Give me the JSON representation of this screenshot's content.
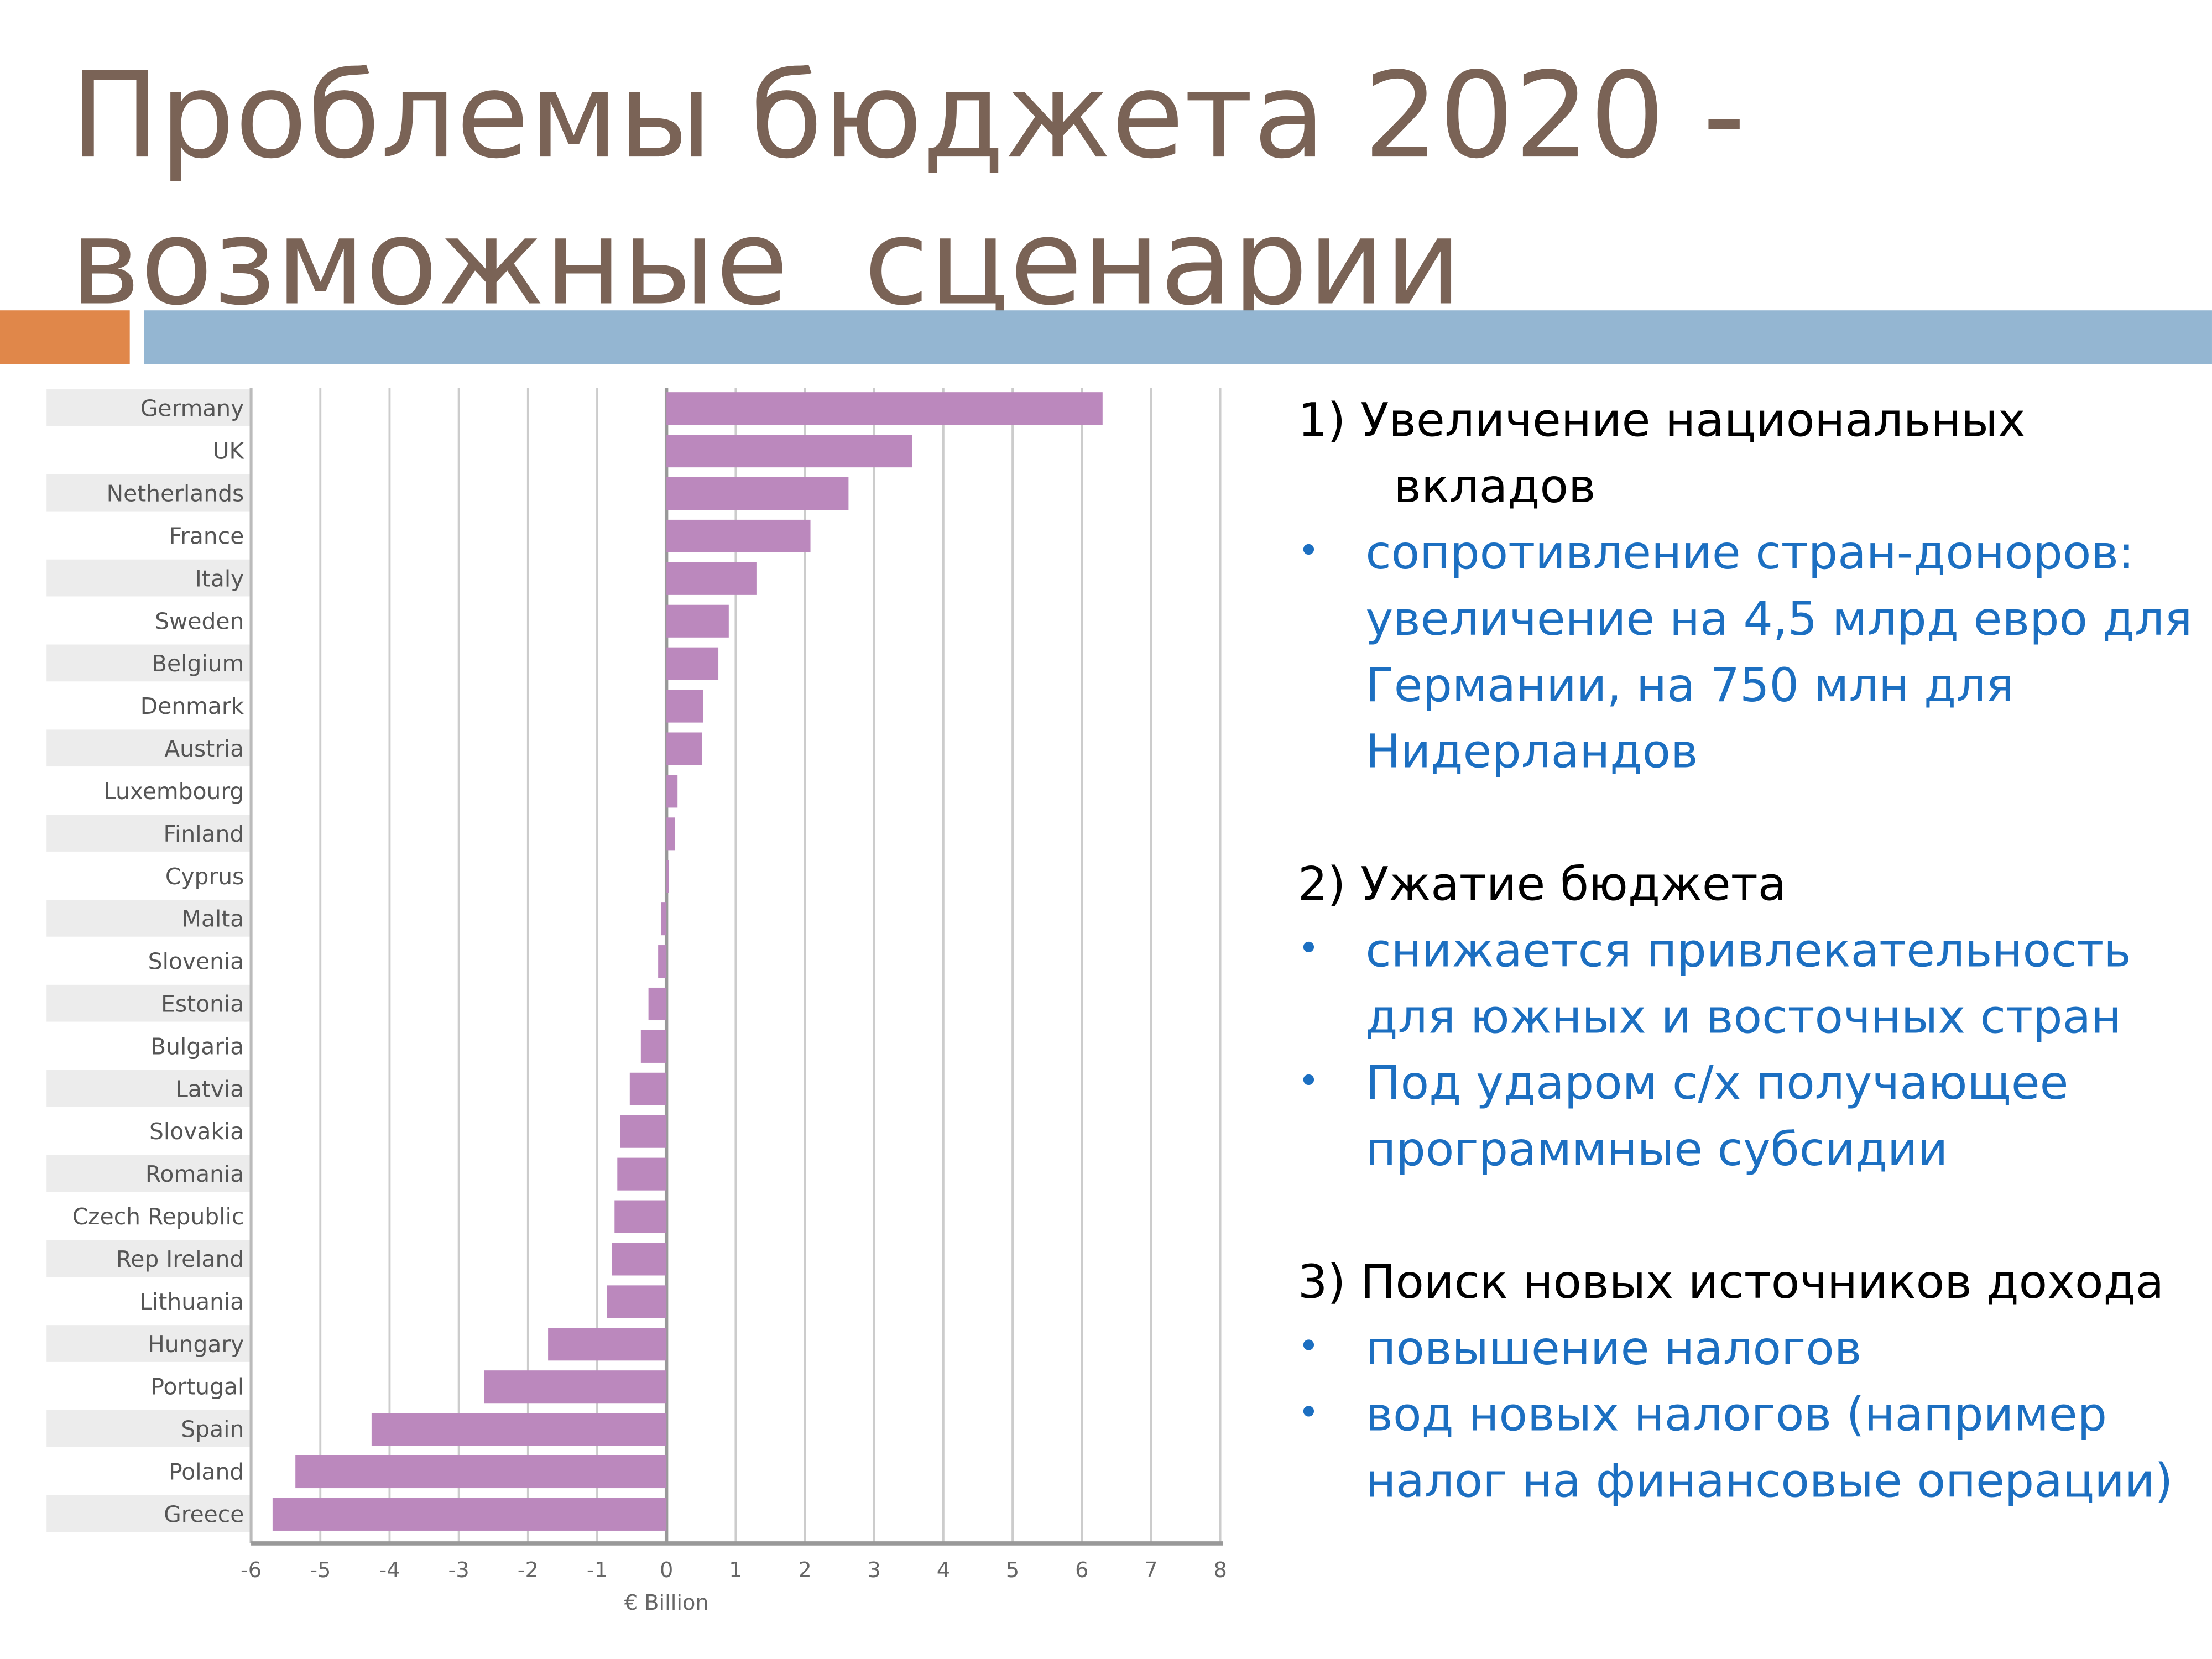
{
  "title": {
    "line1": "Проблемы бюджета 2020 -",
    "line2": "возможные  сценарии"
  },
  "colors": {
    "title": "#7a6356",
    "accent_orange": "#e0874a",
    "accent_blue": "#94b6d2",
    "bar": "#bb88bd",
    "bullet_text": "#1c6fc1"
  },
  "text": {
    "s1_heading_a": "1)  Увеличение национальных",
    "s1_heading_b": "вкладов",
    "s1_bullets": [
      "сопротивление стран-доноров:  увеличение на 4,5 млрд евро  для Германии, на 750 млн для  Нидерландов"
    ],
    "s2_heading": "2) Ужатие бюджета",
    "s2_bullets": [
      "снижается привлекательность для южных и восточных стран",
      "Под ударом с/х получающее программные субсидии"
    ],
    "s3_heading": "3) Поиск новых источников дохода",
    "s3_bullets": [
      "повышение налогов",
      "вод новых налогов (например  налог на финансовые операции)"
    ],
    "bullet_glyph": "•"
  },
  "chart_data": {
    "type": "bar",
    "orientation": "horizontal",
    "categories": [
      "Germany",
      "UK",
      "Netherlands",
      "France",
      "Italy",
      "Sweden",
      "Belgium",
      "Denmark",
      "Austria",
      "Luxembourg",
      "Finland",
      "Cyprus",
      "Malta",
      "Slovenia",
      "Estonia",
      "Bulgaria",
      "Latvia",
      "Slovakia",
      "Romania",
      "Czech Republic",
      "Rep Ireland",
      "Lithuania",
      "Hungary",
      "Portugal",
      "Spain",
      "Poland",
      "Greece"
    ],
    "values": [
      6.3,
      3.55,
      2.63,
      2.08,
      1.3,
      0.9,
      0.75,
      0.53,
      0.51,
      0.16,
      0.12,
      0.03,
      -0.08,
      -0.12,
      -0.26,
      -0.37,
      -0.53,
      -0.67,
      -0.71,
      -0.75,
      -0.79,
      -0.86,
      -1.71,
      -2.63,
      -4.26,
      -5.36,
      -5.69
    ],
    "xlabel": "€ Billion",
    "xlim": [
      -6,
      8
    ],
    "xticks": [
      "-6",
      "-5",
      "-4",
      "-3",
      "-2",
      "-1",
      "0",
      "1",
      "2",
      "3",
      "4",
      "5",
      "6",
      "7",
      "8"
    ],
    "grid": true
  }
}
